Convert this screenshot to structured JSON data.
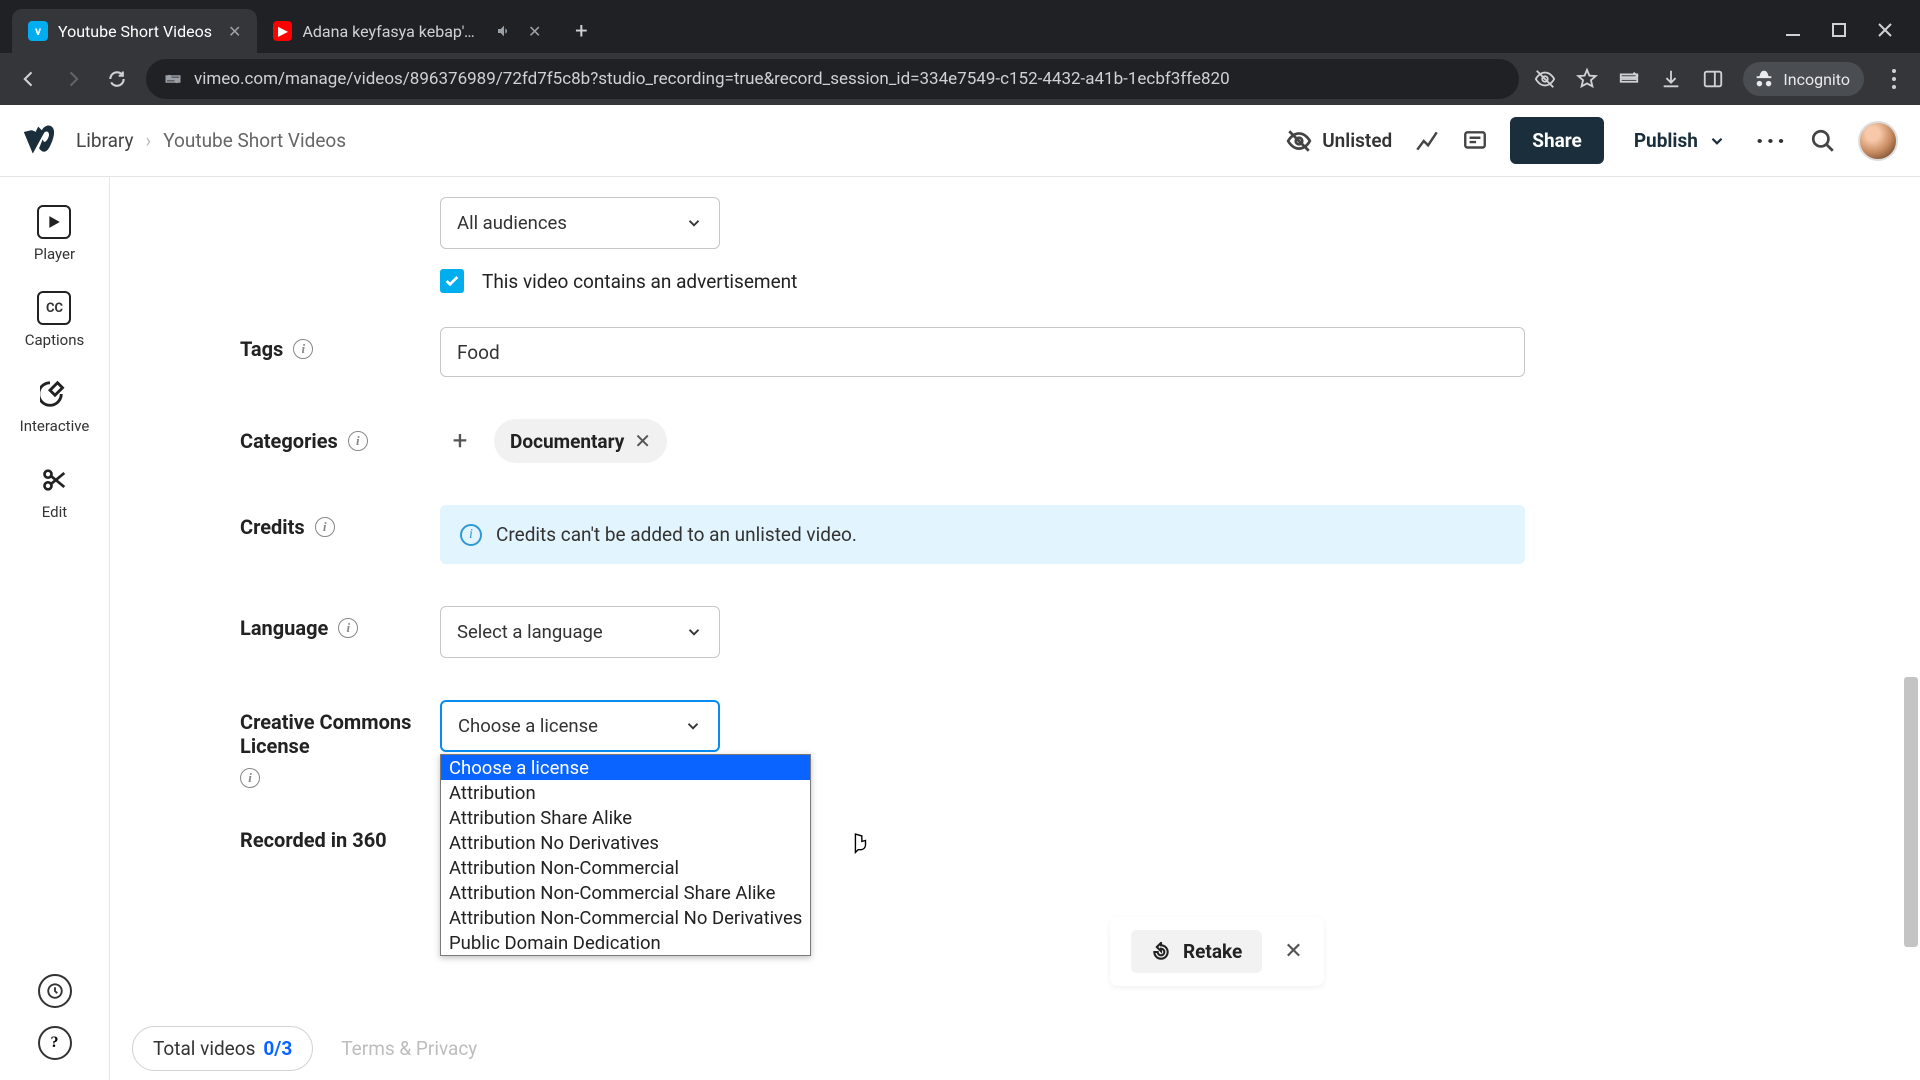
{
  "browser": {
    "tabs": [
      {
        "title": "Youtube Short Videos",
        "active": true,
        "favicon": "vimeo"
      },
      {
        "title": "Adana keyfasya kebap'dan",
        "active": false,
        "favicon": "youtube",
        "audio": true
      }
    ],
    "url": "vimeo.com/manage/videos/896376989/72fd7f5c8b?studio_recording=true&record_session_id=334e7549-c152-4432-a41b-1ecbf3ffe820",
    "incognito_label": "Incognito"
  },
  "header": {
    "breadcrumb": {
      "root": "Library",
      "current": "Youtube Short Videos"
    },
    "privacy": "Unlisted",
    "share": "Share",
    "publish": "Publish"
  },
  "sidebar": {
    "items": [
      {
        "label": "Player"
      },
      {
        "label": "Captions"
      },
      {
        "label": "Interactive"
      },
      {
        "label": "Edit"
      }
    ]
  },
  "form": {
    "audiences": {
      "value": "All audiences"
    },
    "ad_checkbox": {
      "checked": true,
      "label": "This video contains an advertisement"
    },
    "tags": {
      "label": "Tags",
      "value": "Food"
    },
    "categories": {
      "label": "Categories",
      "chips": [
        "Documentary"
      ]
    },
    "credits": {
      "label": "Credits",
      "banner": "Credits can't be added to an unlisted video."
    },
    "language": {
      "label": "Language",
      "placeholder": "Select a language"
    },
    "license": {
      "label": "Creative Commons License",
      "placeholder": "Choose a license",
      "options": [
        "Choose a license",
        "Attribution",
        "Attribution Share Alike",
        "Attribution No Derivatives",
        "Attribution Non-Commercial",
        "Attribution Non-Commercial Share Alike",
        "Attribution Non-Commercial No Derivatives",
        "Public Domain Dedication"
      ],
      "selected_index": 0
    },
    "recorded_360": {
      "label": "Recorded in 360"
    }
  },
  "retake": {
    "label": "Retake"
  },
  "footer": {
    "total_label": "Total videos",
    "count": "0/3",
    "terms": "Terms & Privacy"
  }
}
